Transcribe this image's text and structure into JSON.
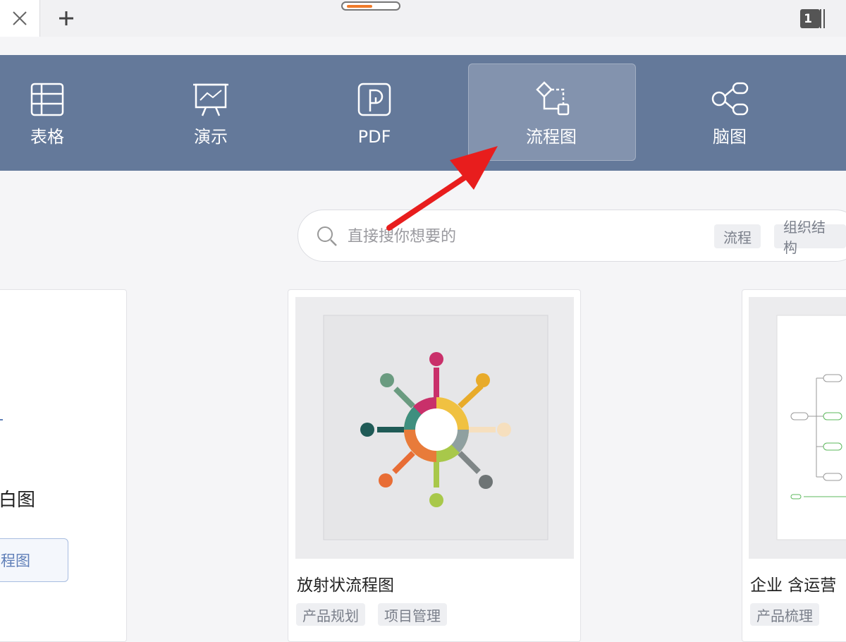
{
  "tabbar": {
    "new_tab_icon": "plus-icon",
    "close_icon": "close-icon",
    "window_count": "1"
  },
  "categories": [
    {
      "label": "表格",
      "icon": "table-icon"
    },
    {
      "label": "演示",
      "icon": "presentation-icon"
    },
    {
      "label": "PDF",
      "icon": "pdf-icon"
    },
    {
      "label": "流程图",
      "icon": "flowchart-icon",
      "active": true
    },
    {
      "label": "脑图",
      "icon": "mindmap-icon"
    }
  ],
  "search": {
    "placeholder": "直接搜你想要的",
    "chips": [
      "流程",
      "组织结构"
    ]
  },
  "left_card": {
    "title_partial": "白图",
    "button_partial": "程图"
  },
  "cards": [
    {
      "title": "放射状流程图",
      "tags": [
        "产品规划",
        "项目管理"
      ]
    },
    {
      "title": "企业  含运营",
      "tags": [
        "产品梳理"
      ]
    }
  ],
  "colors": {
    "band": "#64799a",
    "accent": "#f07b2a",
    "annotation_arrow": "#e81d1d"
  }
}
